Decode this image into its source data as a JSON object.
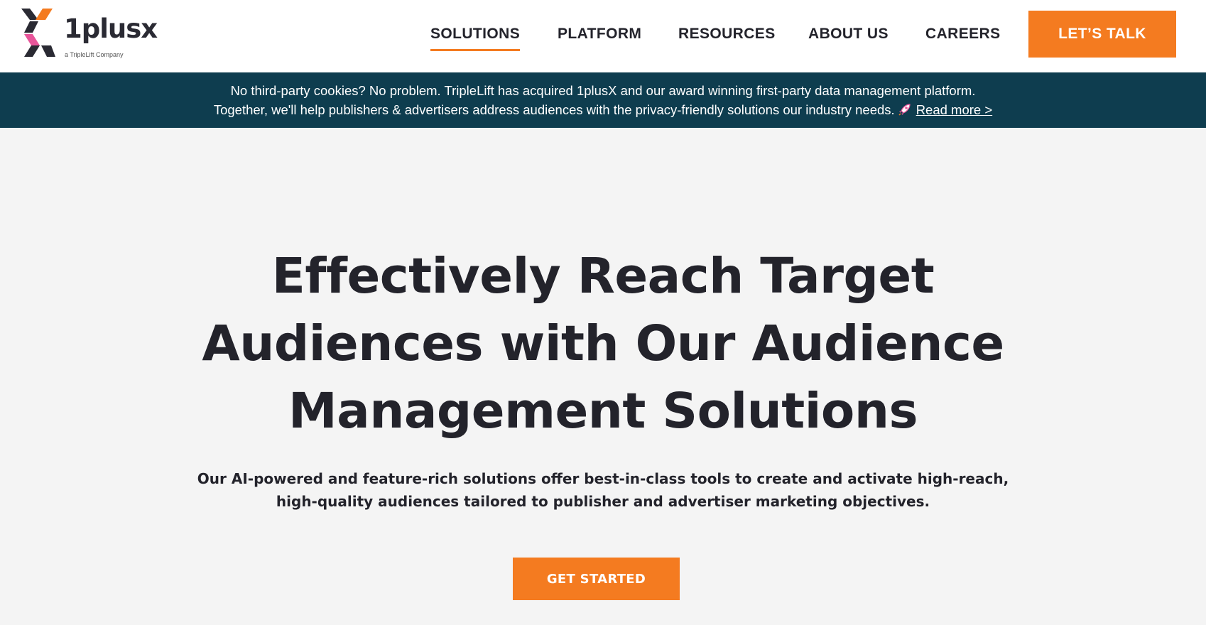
{
  "brand": {
    "wordmark": "1plusx",
    "tagline": "a TripleLift Company",
    "colors": {
      "orange": "#f47b20",
      "pink": "#e8559a",
      "dark": "#2a2a33",
      "teal": "#0e3d4f"
    }
  },
  "nav": {
    "items": [
      {
        "label": "SOLUTIONS",
        "active": true
      },
      {
        "label": "PLATFORM",
        "active": false
      },
      {
        "label": "RESOURCES",
        "active": false
      },
      {
        "label": "ABOUT US",
        "active": false
      },
      {
        "label": "CAREERS",
        "active": false
      }
    ],
    "cta_label": "LET’S TALK"
  },
  "banner": {
    "line1": "No third-party cookies? No problem. TripleLift has acquired 1plusX and our award winning first-party data management platform.",
    "line2": "Together, we'll help publishers & advertisers address audiences with the privacy-friendly solutions our industry needs.",
    "icon": "rocket-icon",
    "link_label": "Read more >"
  },
  "hero": {
    "title_line1": "Effectively Reach Target",
    "title_line2": "Audiences with Our Audience",
    "title_line3": "Management Solutions",
    "subtitle_line1": "Our AI-powered and feature-rich solutions offer best-in-class tools to create and activate high-reach,",
    "subtitle_line2": "high-quality audiences tailored to publisher and advertiser marketing objectives.",
    "cta_label": "GET STARTED"
  }
}
